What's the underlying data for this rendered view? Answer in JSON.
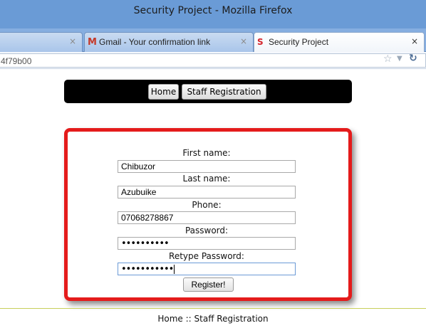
{
  "window": {
    "title": "Security Project - Mozilla Firefox"
  },
  "tabs": [
    {
      "title": "",
      "favicon": "none",
      "active": false
    },
    {
      "title": "Gmail - Your confirmation link",
      "favicon": "gmail-icon",
      "active": false
    },
    {
      "title": "Security Project",
      "favicon": "security-s-icon",
      "active": true
    }
  ],
  "tab_close_glyph": "×",
  "address_bar": {
    "url_fragment": "4f79b00"
  },
  "site_nav": {
    "home_label": "Home",
    "staff_registration_label": "Staff Registration"
  },
  "form": {
    "first_name": {
      "label": "First name:",
      "value": "Chibuzor"
    },
    "last_name": {
      "label": "Last name:",
      "value": "Azubuike"
    },
    "phone": {
      "label": "Phone:",
      "value": "07068278867"
    },
    "password": {
      "label": "Password:",
      "masked_value": "••••••••••"
    },
    "retype_password": {
      "label": "Retype Password:",
      "masked_value": "•••••••••••"
    },
    "submit_label": "Register!"
  },
  "footer": {
    "links_text": "Home :: Staff Registration"
  },
  "colors": {
    "card_border": "#e41b1b",
    "nav_background": "#000000",
    "titlebar": "#6a9bd6"
  }
}
